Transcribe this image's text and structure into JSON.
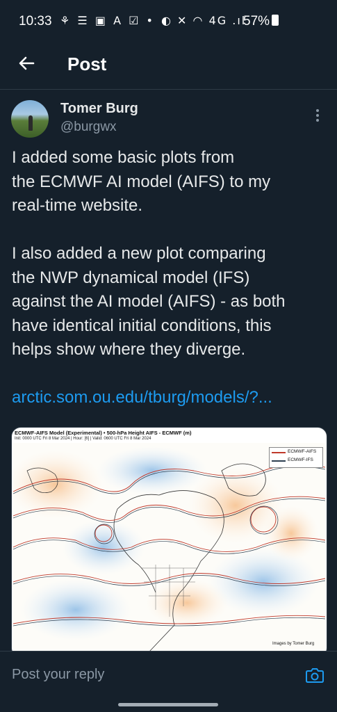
{
  "status_bar": {
    "time": "10:33",
    "left_icons": "⚘ ☰ ▣ A ☑ •",
    "right_icons": "◐ ✕ ◠ 4G .ıl",
    "battery": "57%"
  },
  "header": {
    "back_icon": "arrow-left-icon",
    "title": "Post"
  },
  "author": {
    "name": "Tomer Burg",
    "handle": "@burgwx"
  },
  "post": {
    "text": "I added some basic plots from\nthe ECMWF AI model (AIFS) to my\nreal-time website.\n\nI also added a new plot comparing\nthe NWP dynamical model (IFS)\nagainst the AI model (AIFS) - as both\nhave identical initial conditions, this\nhelps show where they diverge.",
    "link": "arctic.som.ou.edu/tburg/models/?..."
  },
  "media": {
    "title": "ECMWF-AIFS Model (Experimental) • 500-hPa Height AIFS - ECMWF (m)",
    "subtitle": "Init: 0000 UTC Fri 8 Mar 2024 | Hour: [6] | Valid: 0600 UTC Fri 8 Mar 2024",
    "legend": [
      "ECMWF-AIFS",
      "ECMWF-IFS"
    ],
    "colors": {
      "aifs": "#c0392b",
      "ifs": "#2c3e50"
    },
    "credit": "Images by Tomer Burg"
  },
  "reply": {
    "placeholder": "Post your reply",
    "camera_icon": "camera-icon"
  }
}
